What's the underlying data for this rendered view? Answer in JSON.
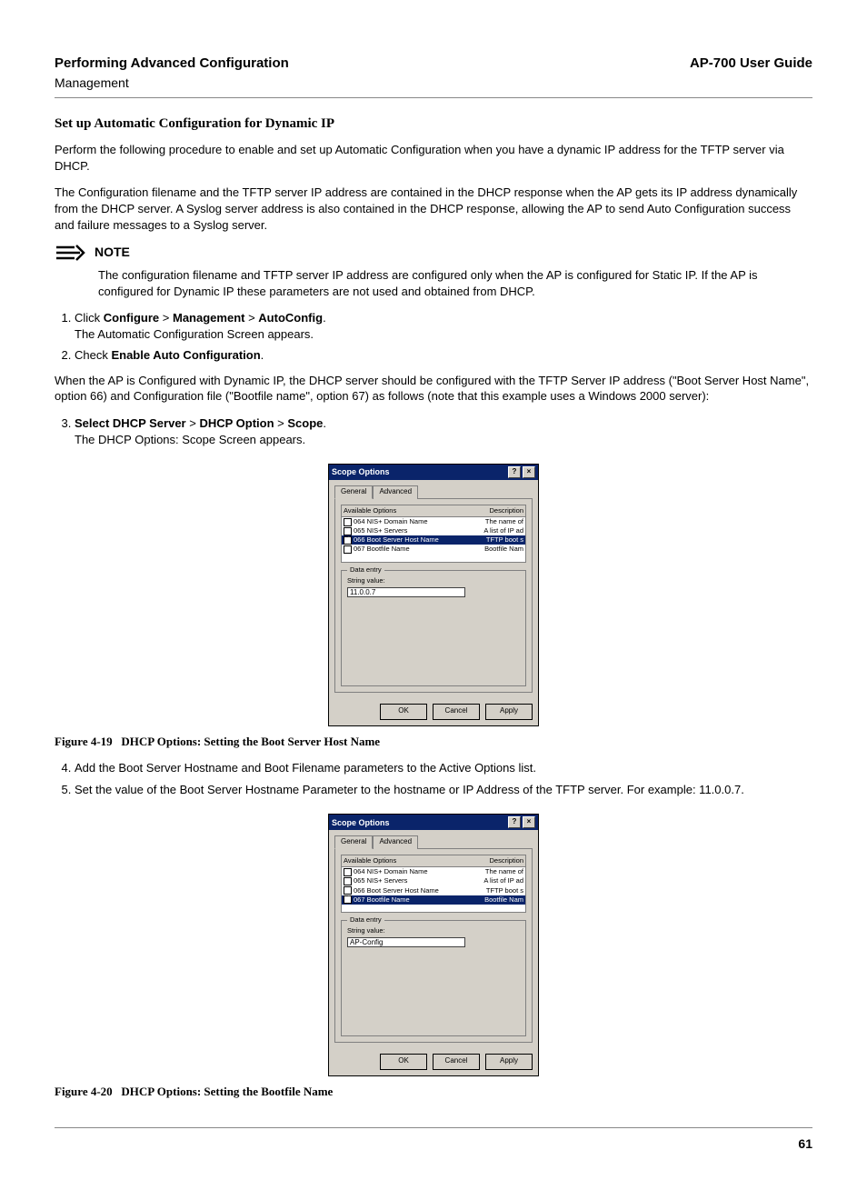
{
  "header": {
    "left_title": "Performing Advanced Configuration",
    "right_title": "AP-700 User Guide",
    "subhead": "Management"
  },
  "section_title": "Set up Automatic Configuration for Dynamic IP",
  "para1": "Perform the following procedure to enable and set up Automatic Configuration when you have a dynamic IP address for the TFTP server via DHCP.",
  "para2": "The Configuration filename and the TFTP server IP address are contained in the DHCP response when the AP gets its IP address dynamically from the DHCP server. A Syslog server address is also contained in the DHCP response, allowing the AP to send Auto Configuration success and failure messages to a Syslog server.",
  "note_label": "NOTE",
  "note_text": "The configuration filename and TFTP server IP address are configured only when the AP is configured for Static IP. If the AP is configured for Dynamic IP these parameters are not used and obtained from DHCP.",
  "step1": {
    "prefix": "Click ",
    "p1": "Configure",
    "sep": " > ",
    "p2": "Management",
    "p3": "AutoConfig",
    "suffix": ".",
    "line2": "The Automatic Configuration Screen appears."
  },
  "step2": {
    "prefix": "Check ",
    "bold": "Enable Auto Configuration",
    "suffix": "."
  },
  "para3": "When the AP is Configured with Dynamic IP, the DHCP server should be configured with the TFTP Server IP address (\"Boot Server Host Name\", option 66) and Configuration file (\"Bootfile name\", option 67) as follows (note that this example uses a Windows 2000 server):",
  "step3": {
    "b1": "Select DHCP Server",
    "sep": " > ",
    "b2": "DHCP Option",
    "b3": "Scope",
    "suffix": ".",
    "line2": "The DHCP Options: Scope Screen appears."
  },
  "caption1": {
    "fig": "Figure 4-19",
    "text": "DHCP Options: Setting the Boot Server Host Name"
  },
  "steps45": {
    "s4": "Add the Boot Server Hostname and Boot Filename parameters to the Active Options list.",
    "s5": "Set the value of the Boot Server Hostname Parameter to the hostname or IP Address of the TFTP server. For example: 11.0.0.7."
  },
  "caption2": {
    "fig": "Figure 4-20",
    "text": "DHCP Options: Setting the Bootfile Name"
  },
  "page_number": "61",
  "dialog": {
    "title": "Scope Options",
    "help_btn": "?",
    "close_btn": "×",
    "tab_general": "General",
    "tab_advanced": "Advanced",
    "col_available": "Available Options",
    "col_description": "Description",
    "options": [
      {
        "code": "064",
        "label": "NIS+ Domain Name",
        "desc": "The name of"
      },
      {
        "code": "065",
        "label": "NIS+ Servers",
        "desc": "A list of IP ad"
      },
      {
        "code": "066",
        "label": "Boot Server Host Name",
        "desc": "TFTP boot s"
      },
      {
        "code": "067",
        "label": "Bootfile Name",
        "desc": "Bootfile Nam"
      }
    ],
    "data_entry_label": "Data entry",
    "string_value_label": "String value:",
    "string_value_a": "11.0.0.7",
    "string_value_b": "AP-Config",
    "ok": "OK",
    "cancel": "Cancel",
    "apply": "Apply"
  }
}
